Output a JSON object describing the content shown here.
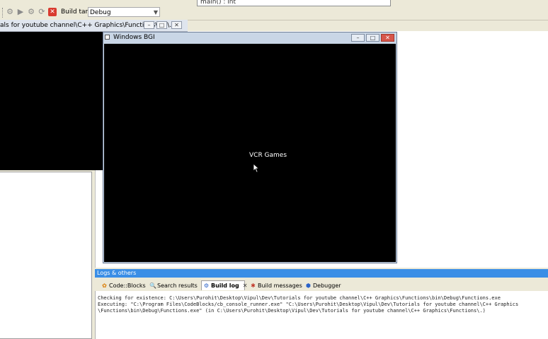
{
  "toolbar": {
    "function_combo": "main() : int",
    "build_target_label": "Build target:",
    "build_target_value": "Debug",
    "icons": [
      "gear-icon",
      "run-icon",
      "build-run-icon",
      "rebuild-icon",
      "stop-icon"
    ]
  },
  "console_window": {
    "title": "als for youtube channel\\C++ Graphics\\Functions\\bin\\..."
  },
  "bgi_window": {
    "title": "Windows BGI",
    "content_text": "VCR Games"
  },
  "logs": {
    "header": "Logs & others",
    "tabs": [
      {
        "label": "Code::Blocks",
        "icon": "codeblocks-icon"
      },
      {
        "label": "Search results",
        "icon": "search-icon"
      },
      {
        "label": "Build log",
        "icon": "build-log-icon",
        "active": true
      },
      {
        "label": "Build messages",
        "icon": "build-messages-icon"
      },
      {
        "label": "Debugger",
        "icon": "debugger-icon"
      }
    ],
    "lines": [
      "Checking for existence: C:\\Users\\Purohit\\Desktop\\Vipul\\Dev\\Tutorials for youtube channel\\C++ Graphics\\Functions\\bin\\Debug\\Functions.exe",
      "Executing: \"C:\\Program Files\\CodeBlocks/cb_console_runner.exe\" \"C:\\Users\\Purohit\\Desktop\\Vipul\\Dev\\Tutorials for youtube channel\\C++ Graphics",
      "\\Functions\\bin\\Debug\\Functions.exe\"  (in C:\\Users\\Purohit\\Desktop\\Vipul\\Dev\\Tutorials for youtube channel\\C++ Graphics\\Functions\\.)"
    ]
  },
  "colors": {
    "logs_header": "#3a8ee6",
    "canvas": "#000000",
    "close_button": "#d7564a"
  }
}
